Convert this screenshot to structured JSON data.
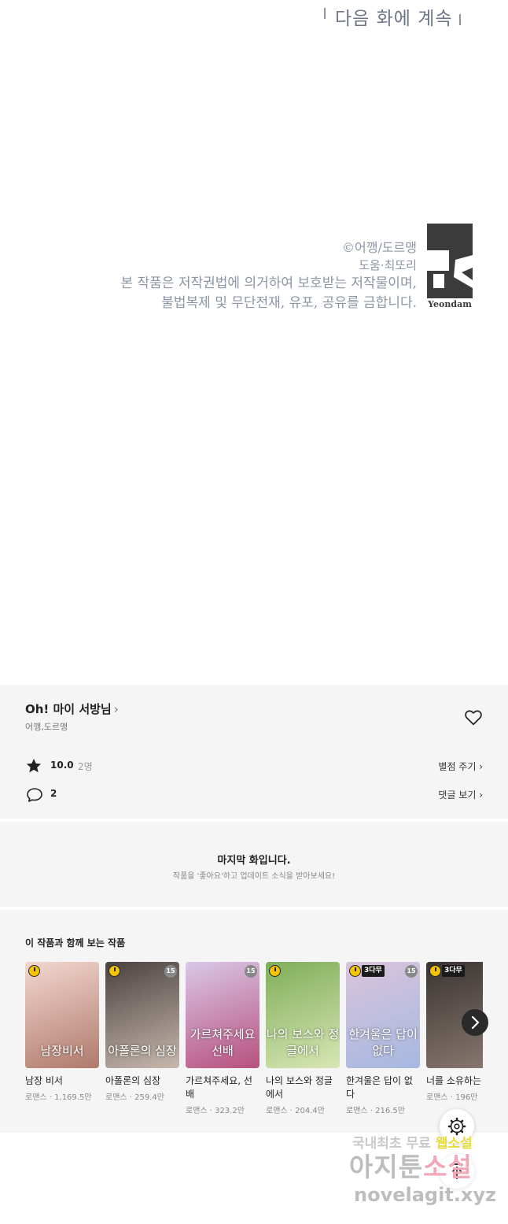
{
  "comic": {
    "next_episode_text": "다음 화에 계속",
    "copyright": "©어깽/도르맹",
    "assist": "도움·최또리",
    "notice_line1": "본 작품은 저작권법에 의거하여 보호받는 저작물이며,",
    "notice_line2": "불법복제 및 무단전재, 유포, 공유를 금합니다.",
    "publisher_logo_text": "Yeondam"
  },
  "work": {
    "title": "Oh! 마이 서방님",
    "title_chevron": "›",
    "author": "어깽,도르맹",
    "rating": "10.0",
    "raters": "2명",
    "rate_button": "별점 주기 ›",
    "comment_count": "2",
    "comments_button": "댓글 보기 ›"
  },
  "last_episode": {
    "title": "마지막 화입니다.",
    "subtitle": "작품을 '좋아요'하고 업데이트 소식을 받아보세요!"
  },
  "recommendations": {
    "heading": "이 작품과 함께 보는 작품",
    "items": [
      {
        "name": "남장 비서",
        "genre": "로맨스",
        "views": "1,169.5만",
        "caption": "남장비서",
        "badge_age": "",
        "badge_free": "",
        "colors": [
          "#f2d7cf",
          "#b07a6c"
        ]
      },
      {
        "name": "아폴론의 심장",
        "genre": "로맨스",
        "views": "259.4만",
        "caption": "아폴론의 심장",
        "badge_age": "15",
        "badge_free": "",
        "colors": [
          "#4a4240",
          "#c7b8ad"
        ]
      },
      {
        "name": "가르쳐주세요, 선배",
        "genre": "로맨스",
        "views": "323.2만",
        "caption": "가르쳐주세요 선배",
        "badge_age": "15",
        "badge_free": "",
        "colors": [
          "#d9c8e8",
          "#b8507e"
        ]
      },
      {
        "name": "나의 보스와 정글에서",
        "genre": "로맨스",
        "views": "204.4만",
        "caption": "나의 보스와 정글에서",
        "badge_age": "",
        "badge_free": "",
        "colors": [
          "#7fae5a",
          "#d8e6b4"
        ]
      },
      {
        "name": "한겨울은 답이 없다",
        "genre": "로맨스",
        "views": "216.5만",
        "caption": "한겨울은 답이 없다",
        "badge_age": "15",
        "badge_free": "3다무",
        "colors": [
          "#d9c4dc",
          "#a6b8e0"
        ]
      },
      {
        "name": "너를 소유하는",
        "genre": "로맨스",
        "views": "196만",
        "caption": "",
        "badge_age": "",
        "badge_free": "3다무",
        "colors": [
          "#3a3432",
          "#8a7a70"
        ]
      }
    ]
  },
  "watermark": {
    "line1_a": "국내최초 무료",
    "line1_b": "웹소설",
    "line2_a": "아지툰",
    "line2_b": "소설",
    "line3": "novelagit.xyz"
  },
  "colors": {
    "panel_bg": "#f5f5f5",
    "text_dark": "#222222",
    "text_muted": "#888888",
    "credit_gray": "#8c95a3"
  }
}
